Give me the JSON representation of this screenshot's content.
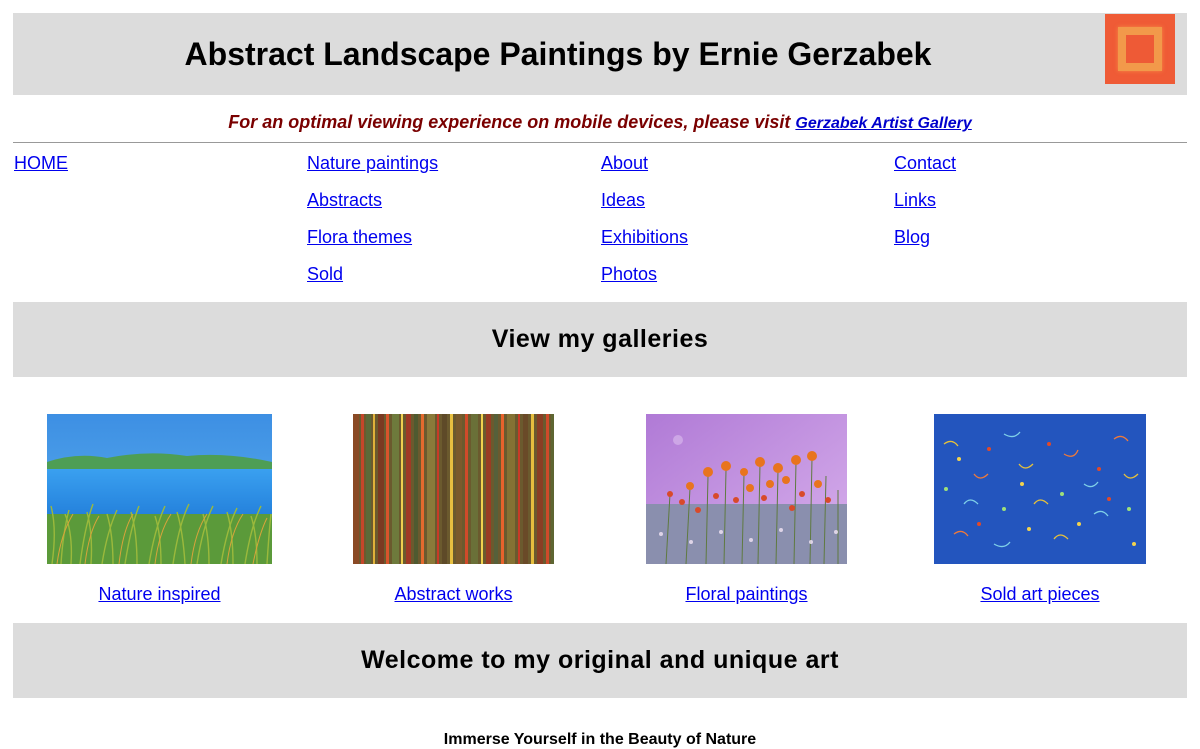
{
  "header": {
    "title": "Abstract Landscape Paintings by Ernie Gerzabek",
    "logo_colors": [
      "#ef5b36",
      "#f2994a"
    ]
  },
  "mobile_note": {
    "text": "For an optimal viewing experience on mobile devices, please visit ",
    "link_label": "Gerzabek Artist Gallery"
  },
  "nav": {
    "col1": [
      "HOME"
    ],
    "col2": [
      "Nature paintings",
      "Abstracts",
      "Flora themes",
      "Sold"
    ],
    "col3": [
      "About",
      "Ideas",
      "Exhibitions",
      "Photos"
    ],
    "col4": [
      "Contact",
      "Links",
      "Blog"
    ]
  },
  "galleries": {
    "heading": "View my galleries",
    "items": [
      {
        "label": "Nature inspired",
        "icon": "nature-painting-thumbnail"
      },
      {
        "label": "Abstract works",
        "icon": "abstract-painting-thumbnail"
      },
      {
        "label": "Floral paintings",
        "icon": "floral-painting-thumbnail"
      },
      {
        "label": "Sold art pieces",
        "icon": "sold-painting-thumbnail"
      }
    ]
  },
  "welcome": {
    "heading": "Welcome to my original and unique art",
    "subheading": "Immerse Yourself in the Beauty of Nature"
  }
}
